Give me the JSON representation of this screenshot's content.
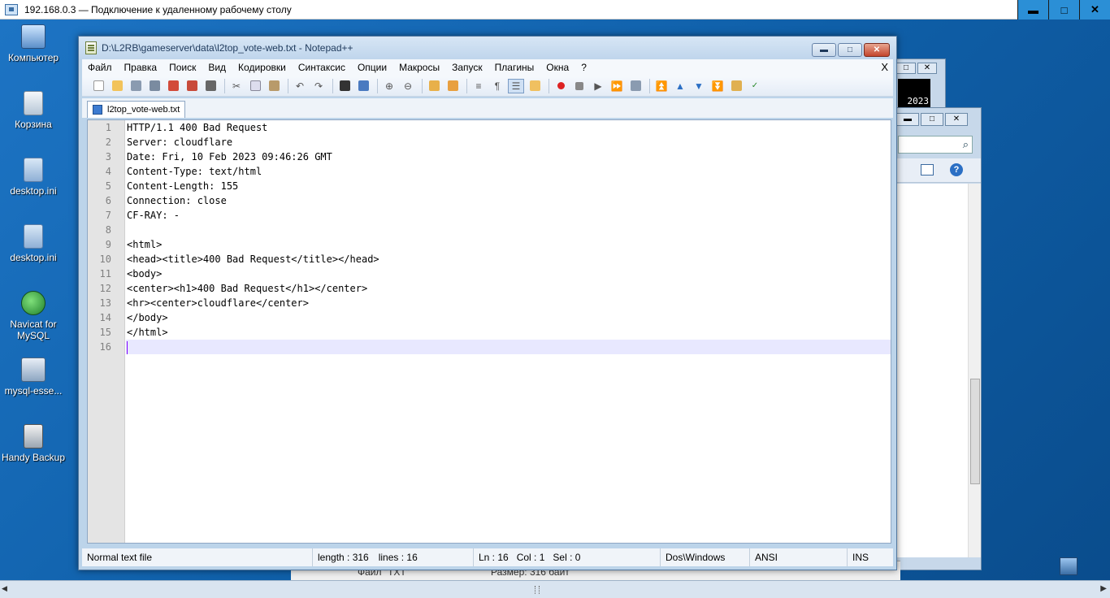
{
  "rdp": {
    "title": "192.168.0.3 — Подключение к удаленному рабочему столу",
    "minimize": "▬",
    "maximize": "□",
    "close": "✕"
  },
  "desktop": {
    "icons": [
      {
        "label": "Компьютер",
        "icon": "computer-icon"
      },
      {
        "label": "Корзина",
        "icon": "recycle-bin-icon"
      },
      {
        "label": "desktop.ini",
        "icon": "ini-file-icon"
      },
      {
        "label": "desktop.ini",
        "icon": "ini-file-icon"
      },
      {
        "label": "Navicat for MySQL",
        "icon": "navicat-icon"
      },
      {
        "label": "mysql-esse...",
        "icon": "installer-icon"
      },
      {
        "label": "Handy Backup",
        "icon": "backup-icon"
      }
    ]
  },
  "background": {
    "clock_fragment": "2023",
    "status_file": "Файл \"TXT\"",
    "status_size": "Размер: 316 байт"
  },
  "notepad": {
    "title": "D:\\L2RB\\gameserver\\data\\l2top_vote-web.txt - Notepad++",
    "menu": [
      "Файл",
      "Правка",
      "Поиск",
      "Вид",
      "Кодировки",
      "Синтаксис",
      "Опции",
      "Макросы",
      "Запуск",
      "Плагины",
      "Окна",
      "?"
    ],
    "menu_close": "X",
    "tab": "l2top_vote-web.txt",
    "lines": [
      "HTTP/1.1 400 Bad Request",
      "Server: cloudflare",
      "Date: Fri, 10 Feb 2023 09:46:26 GMT",
      "Content-Type: text/html",
      "Content-Length: 155",
      "Connection: close",
      "CF-RAY: -",
      "",
      "<html>",
      "<head><title>400 Bad Request</title></head>",
      "<body>",
      "<center><h1>400 Bad Request</h1></center>",
      "<hr><center>cloudflare</center>",
      "</body>",
      "</html>",
      ""
    ],
    "current_line": 16,
    "status": {
      "type": "Normal text file",
      "length": "length : 316",
      "lines": "lines : 16",
      "ln": "Ln : 16",
      "col": "Col : 1",
      "sel": "Sel : 0",
      "eol": "Dos\\Windows",
      "encoding": "ANSI",
      "mode": "INS"
    }
  }
}
